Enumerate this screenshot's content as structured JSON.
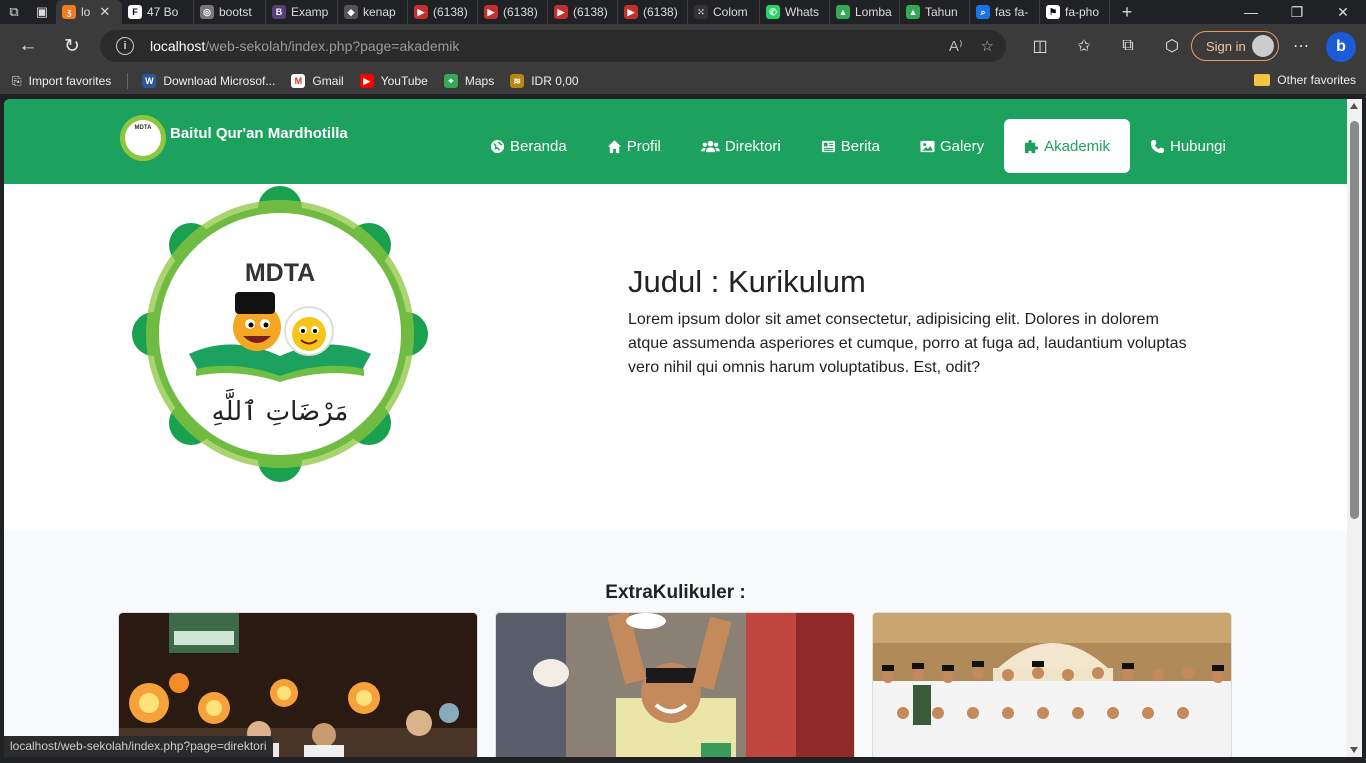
{
  "browser": {
    "tabs": [
      {
        "label": "lo",
        "active": true
      },
      {
        "label": "47 Bo"
      },
      {
        "label": "bootst"
      },
      {
        "label": "Examp"
      },
      {
        "label": "kenap"
      },
      {
        "label": "(6138)"
      },
      {
        "label": "(6138)"
      },
      {
        "label": "(6138)"
      },
      {
        "label": "(6138)"
      },
      {
        "label": "Colom"
      },
      {
        "label": "Whats"
      },
      {
        "label": "Lomba"
      },
      {
        "label": "Tahun"
      },
      {
        "label": "fas fa-"
      },
      {
        "label": "fa-pho"
      }
    ],
    "url_host": "localhost",
    "url_path": "/web-sekolah/index.php?page=akademik",
    "signin_label": "Sign in",
    "favorites": [
      {
        "label": "Import favorites"
      },
      {
        "label": "Download Microsof..."
      },
      {
        "label": "Gmail"
      },
      {
        "label": "YouTube"
      },
      {
        "label": "Maps"
      },
      {
        "label": "IDR 0,00"
      }
    ],
    "other_favorites": "Other favorites",
    "status_url": "localhost/web-sekolah/index.php?page=direktori"
  },
  "site": {
    "brand": "Baitul Qur'an Mardhotilla",
    "logo_text": "MDTA",
    "menu": [
      {
        "label": "Beranda",
        "icon": "globe-icon"
      },
      {
        "label": "Profil",
        "icon": "home-icon"
      },
      {
        "label": "Direktori",
        "icon": "users-icon"
      },
      {
        "label": "Berita",
        "icon": "newspaper-icon"
      },
      {
        "label": "Galery",
        "icon": "image-icon"
      },
      {
        "label": "Akademik",
        "icon": "puzzle-icon",
        "active": true
      },
      {
        "label": "Hubungi",
        "icon": "phone-icon"
      }
    ],
    "hero": {
      "title": "Judul : Kurikulum",
      "body": "Lorem ipsum dolor sit amet consectetur, adipisicing elit. Dolores in dolorem atque assumenda asperiores et cumque, porro at fuga ad, laudantium voluptas vero nihil qui omnis harum voluptatibus. Est, odit?"
    },
    "extracurricular": {
      "title": "ExtraKulikuler :"
    }
  },
  "colors": {
    "brand_green": "#1da15f",
    "logo_green": "#8dc63f"
  }
}
